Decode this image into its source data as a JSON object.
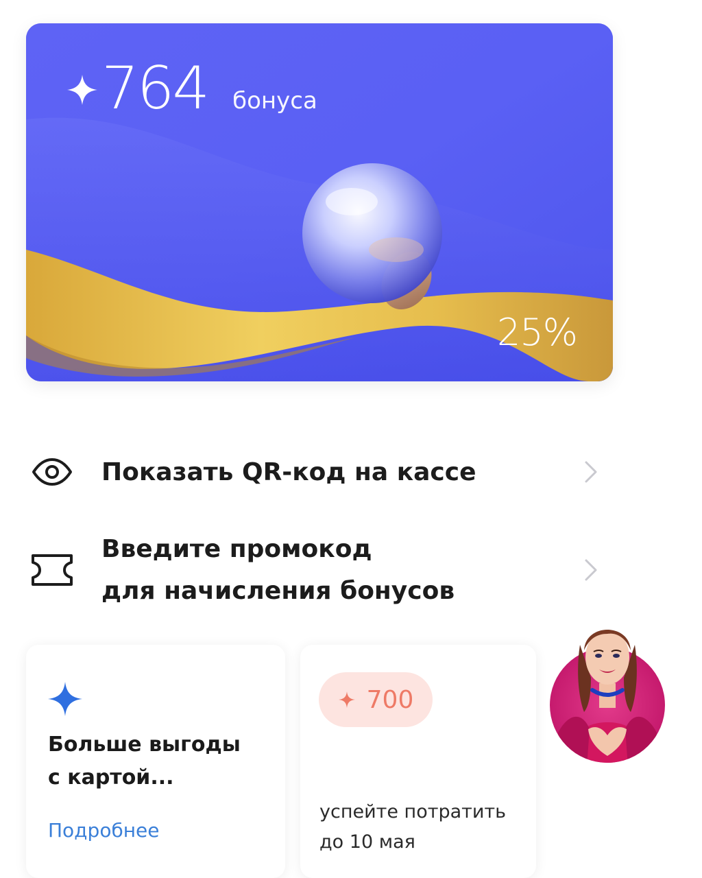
{
  "bonus_card": {
    "amount": "764",
    "unit": "бонуса",
    "percent": "25%",
    "colors": {
      "background": "#5a5ff3",
      "ribbon": "#e8c352"
    }
  },
  "actions": {
    "show_qr": {
      "label": "Показать QR-код на кассе",
      "icon": "eye-icon"
    },
    "promo": {
      "label_line1": "Введите промокод",
      "label_line2": "для начисления бонусов",
      "icon": "ticket-icon"
    }
  },
  "tiles": {
    "benefits": {
      "title_line1": "Больше выгоды",
      "title_line2": "с картой...",
      "link": "Подробнее",
      "icon": "sparkle-icon",
      "accent": "#3a7fd8"
    },
    "expiring": {
      "amount": "700",
      "note_line1": "успейте потратить",
      "note_line2": "до 10 мая",
      "badge_color": "#fde4e0",
      "text_color": "#ee7a66"
    }
  }
}
